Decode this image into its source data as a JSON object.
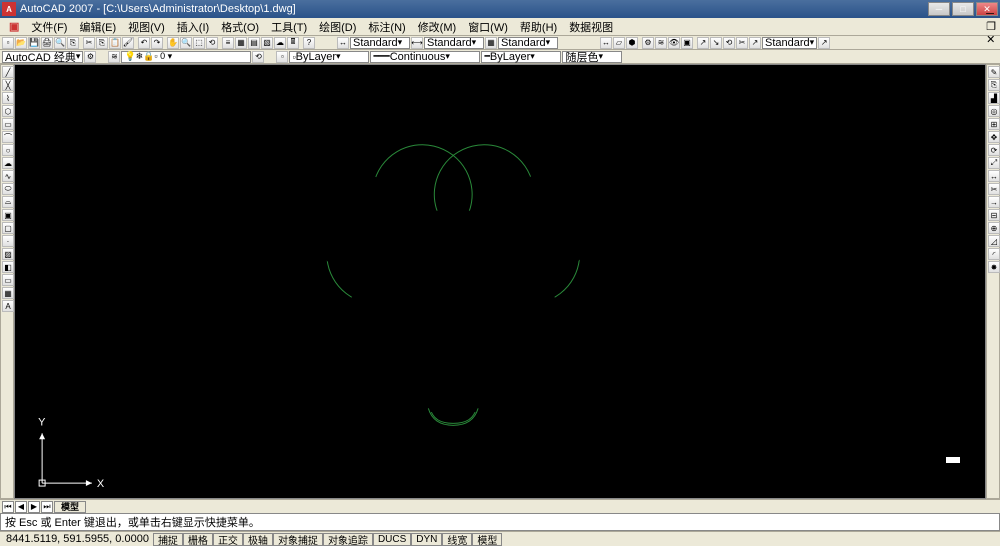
{
  "titlebar": {
    "app": "AutoCAD 2007",
    "file": "[C:\\Users\\Administrator\\Desktop\\1.dwg]"
  },
  "menu": [
    "文件(F)",
    "编辑(E)",
    "视图(V)",
    "插入(I)",
    "格式(O)",
    "工具(T)",
    "绘图(D)",
    "标注(N)",
    "修改(M)",
    "窗口(W)",
    "帮助(H)",
    "数据视图"
  ],
  "tb2": {
    "workspace": "AutoCAD 经典",
    "layer": "ByLayer",
    "linetype": "Continuous",
    "lineweight": "ByLayer",
    "color": "随层色",
    "style1": "Standard",
    "style2": "Standard",
    "style3": "Standard",
    "style4": "Standard"
  },
  "tabs": {
    "active": "模型",
    "others": []
  },
  "cmd": "按 Esc 或 Enter 键退出，或单击右键显示快捷菜单。",
  "status": {
    "coords": "8441.5119, 591.5955, 0.0000",
    "buttons": [
      "捕捉",
      "栅格",
      "正交",
      "极轴",
      "对象捕捉",
      "对象追踪",
      "DUCS",
      "DYN",
      "线宽",
      "模型"
    ]
  },
  "ucs": {
    "x": "X",
    "y": "Y"
  }
}
